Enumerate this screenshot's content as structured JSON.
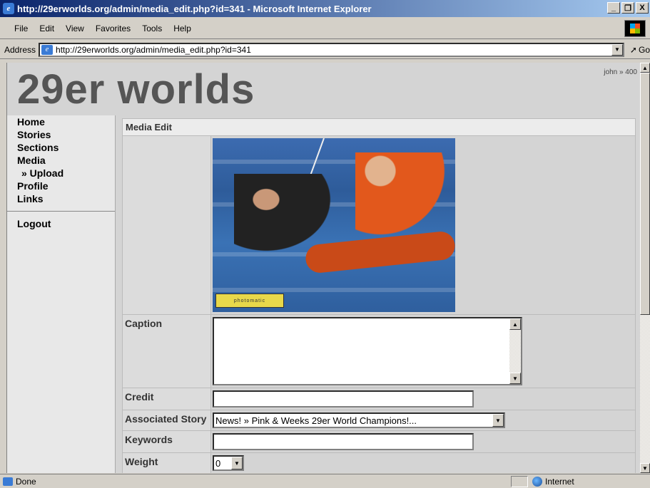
{
  "window": {
    "title": "http://29erworlds.org/admin/media_edit.php?id=341 - Microsoft Internet Explorer",
    "minimize": "_",
    "restore": "❐",
    "close": "X"
  },
  "menu": [
    "File",
    "Edit",
    "View",
    "Favorites",
    "Tools",
    "Help"
  ],
  "address": {
    "label": "Address",
    "url": "http://29erworlds.org/admin/media_edit.php?id=341",
    "go_label": "Go"
  },
  "site": {
    "title": "29er worlds",
    "user_info": "john » 400"
  },
  "sidebar": {
    "items": [
      {
        "label": "Home"
      },
      {
        "label": "Stories"
      },
      {
        "label": "Sections"
      },
      {
        "label": "Media"
      },
      {
        "label": "» Upload"
      },
      {
        "label": "Profile"
      },
      {
        "label": "Links"
      }
    ],
    "logout": "Logout"
  },
  "form": {
    "header": "Media Edit",
    "image_logo": "photomatic",
    "caption_label": "Caption",
    "caption_value": "",
    "credit_label": "Credit",
    "credit_value": "",
    "story_label": "Associated Story",
    "story_value": "News! » Pink & Weeks 29er World Champions!...",
    "keywords_label": "Keywords",
    "keywords_value": "",
    "weight_label": "Weight",
    "weight_value": "0"
  },
  "status": {
    "text": "Done",
    "zone": "Internet"
  }
}
